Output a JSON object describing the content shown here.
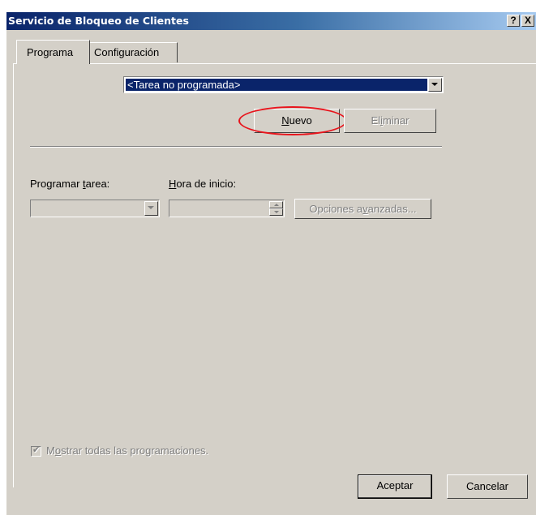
{
  "window": {
    "title": "Servicio de Bloqueo de Clientes",
    "help_label": "?",
    "close_label": "X"
  },
  "tabs": [
    {
      "label": "Programa",
      "selected": true
    },
    {
      "label": "Configuración",
      "selected": false
    }
  ],
  "schedule": {
    "task_combo": {
      "selected_value": "<Tarea no programada>"
    },
    "new_button": {
      "label_pre": "",
      "label_mnemonic": "N",
      "label_post": "uevo"
    },
    "delete_button": {
      "label_pre": "El",
      "label_mnemonic": "i",
      "label_post": "minar"
    },
    "schedule_task_label": {
      "pre": "Programar ",
      "mnemonic": "t",
      "post": "area:"
    },
    "start_time_label": {
      "pre": "",
      "mnemonic": "H",
      "post": "ora de inicio:"
    },
    "advanced_button": {
      "pre": "Opciones a",
      "mnemonic": "v",
      "post": "anzadas..."
    },
    "show_all_checkbox": {
      "pre": "M",
      "mnemonic": "o",
      "post": "strar todas las programaciones.",
      "checked": true,
      "enabled": false
    }
  },
  "footer": {
    "ok_label": "Aceptar",
    "cancel_label": "Cancelar"
  },
  "colors": {
    "title_bar": "#0a246a",
    "dialog_face": "#d4d0c8",
    "selection": "#0a246a",
    "annotation_ring": "#e8141c"
  }
}
